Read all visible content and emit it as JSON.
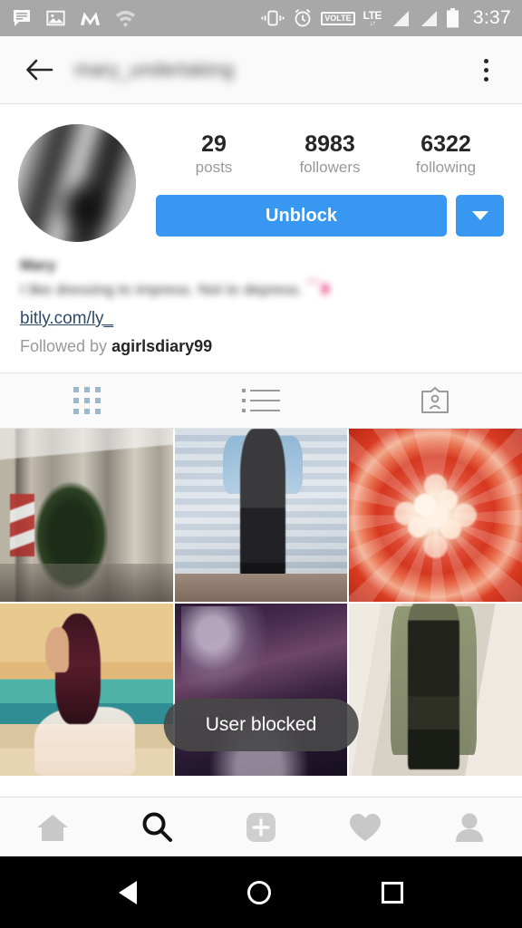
{
  "status_bar": {
    "time": "3:37",
    "volte_label": "VOLTE",
    "network_label": "LTE",
    "data_arrows": "↓↑",
    "left_icons": [
      "message-icon",
      "photo-icon",
      "m-app-icon",
      "wifi-off-icon"
    ],
    "right_icons": [
      "vibrate-icon",
      "alarm-icon",
      "volte-icon",
      "lte-icon",
      "signal-1-icon",
      "signal-2-icon",
      "battery-icon"
    ],
    "background": "#a8a8a8"
  },
  "header": {
    "back_icon": "arrow-left-icon",
    "title": "mary_undertaking",
    "title_blurred": true,
    "overflow_icon": "more-vertical-icon"
  },
  "profile": {
    "avatar_name": "profile-avatar",
    "stats": [
      {
        "value": "29",
        "label": "posts"
      },
      {
        "value": "8983",
        "label": "followers"
      },
      {
        "value": "6322",
        "label": "following"
      }
    ],
    "primary_button": "Unblock",
    "dropdown_icon": "chevron-down-icon",
    "accent_color": "#3897f0"
  },
  "bio": {
    "display_name": "Mary",
    "text": "I like dressing to impress. Not to depress.",
    "emoji": "⁀❥",
    "link": "bitly.com/ly_",
    "link_color": "#2e4a6b",
    "followed_by_prefix": "Followed by",
    "followed_by_user": "agirlsdiary99"
  },
  "tabs": [
    {
      "name": "grid-tab",
      "icon": "grid-icon",
      "active": true
    },
    {
      "name": "list-tab",
      "icon": "list-icon",
      "active": false
    },
    {
      "name": "tagged-tab",
      "icon": "tagged-photos-icon",
      "active": false
    }
  ],
  "photo_grid": {
    "rows": 2,
    "columns": 3,
    "cells": [
      {
        "id": "post-1",
        "description": "Christmas tree inside an airport terminal with American flag"
      },
      {
        "id": "post-2",
        "description": "Person in denim jacket and black outfit against blue wooden wall"
      },
      {
        "id": "post-3",
        "description": "Close-up of a red and white dahlia flower"
      },
      {
        "id": "post-4",
        "description": "Girl with long dark hair in white dress at the beach"
      },
      {
        "id": "post-5",
        "description": "Dark purple toned photo"
      },
      {
        "id": "post-6",
        "description": "Girl in olive green outfit with long scarf"
      }
    ]
  },
  "toast": {
    "message": "User blocked"
  },
  "bottom_nav": [
    {
      "name": "home-tab",
      "icon": "home-icon",
      "active": false
    },
    {
      "name": "search-tab",
      "icon": "search-icon",
      "active": true
    },
    {
      "name": "add-post-tab",
      "icon": "plus-square-icon",
      "active": false
    },
    {
      "name": "activity-tab",
      "icon": "heart-icon",
      "active": false
    },
    {
      "name": "profile-tab",
      "icon": "person-icon",
      "active": false
    }
  ],
  "android_nav": [
    {
      "name": "android-back-button",
      "icon": "triangle-back-icon"
    },
    {
      "name": "android-home-button",
      "icon": "circle-home-icon"
    },
    {
      "name": "android-recents-button",
      "icon": "square-recents-icon"
    }
  ]
}
